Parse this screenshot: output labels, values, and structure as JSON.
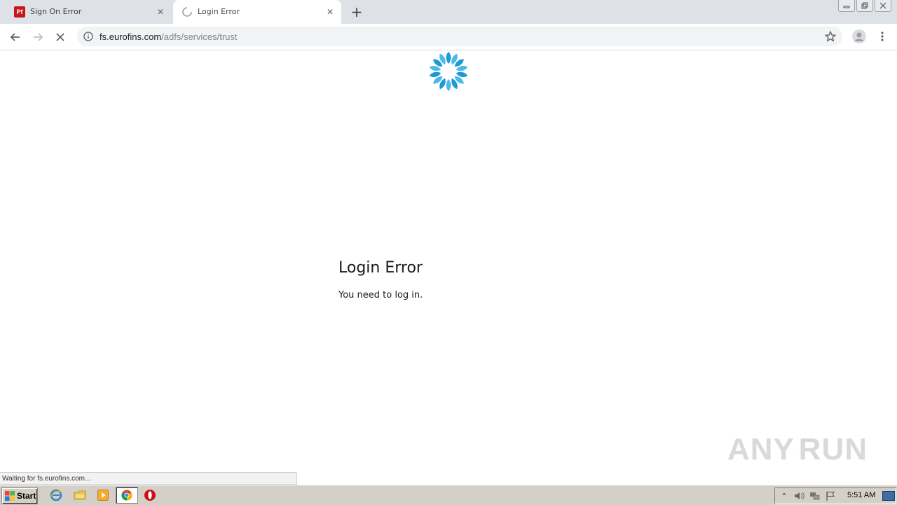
{
  "browser": {
    "tabs": [
      {
        "title": "Sign On Error",
        "favicon": "pf-icon",
        "favicon_text": "Pf",
        "active": false
      },
      {
        "title": "Login Error",
        "favicon": "loading-spinner-icon",
        "active": true
      }
    ],
    "address": {
      "host": "fs.eurofins.com",
      "path": "/adfs/services/trust"
    }
  },
  "page": {
    "heading": "Login Error",
    "message": "You need to log in."
  },
  "status_bar": {
    "text": "Waiting for fs.eurofins.com..."
  },
  "watermark": {
    "left": "ANY",
    "right": "RUN"
  },
  "taskbar": {
    "start_label": "Start",
    "clock": "5:51 AM",
    "apps": [
      "ie-icon",
      "explorer-icon",
      "media-player-icon",
      "chrome-icon",
      "opera-icon"
    ]
  },
  "colors": {
    "logo_blue": "#1a9ad6",
    "tabstrip": "#dee1e6",
    "omnibox": "#f1f3f4",
    "taskbar": "#d4d0c8"
  }
}
